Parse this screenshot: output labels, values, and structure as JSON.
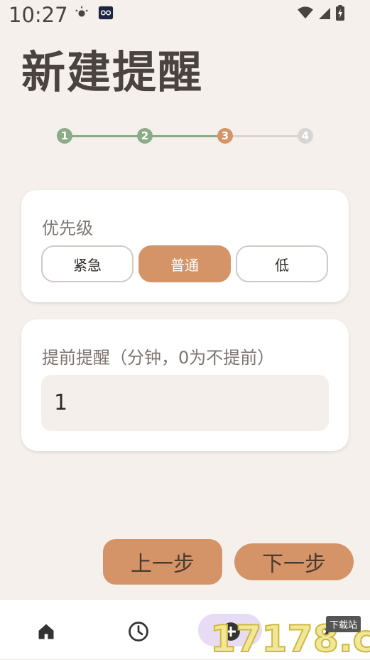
{
  "status_bar": {
    "time": "10:27"
  },
  "title": "新建提醒",
  "stepper": {
    "steps": [
      "1",
      "2",
      "3",
      "4"
    ],
    "colors": {
      "done": "#8aac87",
      "current": "#d49468",
      "pending": "#d8d4d1"
    }
  },
  "priority": {
    "label": "优先级",
    "options": [
      "紧急",
      "普通",
      "低"
    ],
    "selected": "普通"
  },
  "advance": {
    "label": "提前提醒（分钟，0为不提前）",
    "value": "1"
  },
  "buttons": {
    "prev": "上一步",
    "next": "下一步"
  },
  "watermark": {
    "text": "17178.com",
    "tag": "下载站"
  },
  "colors": {
    "accent": "#d49468",
    "background": "#f5f0ec"
  }
}
